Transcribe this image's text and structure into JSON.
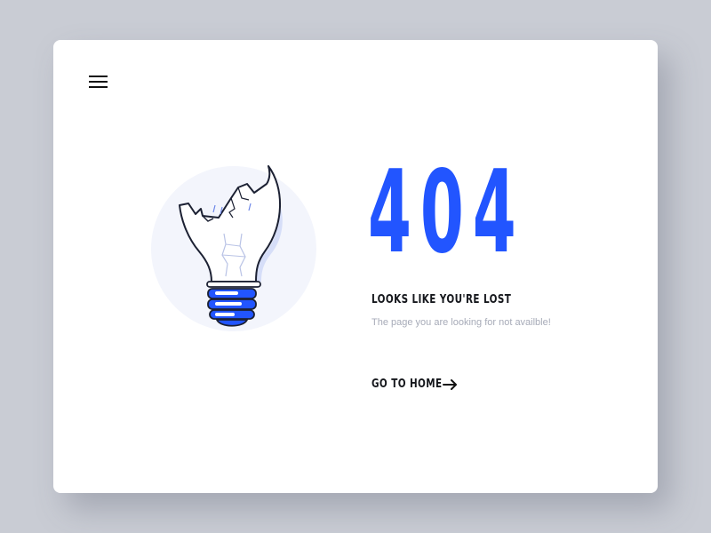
{
  "nav": {
    "menu_icon": "hamburger-menu-icon"
  },
  "illustration": {
    "icon": "broken-lightbulb-icon",
    "accent_color": "#2255ff"
  },
  "error": {
    "code": "404",
    "headline": "LOOKS LIKE YOU'RE LOST",
    "message": "The page you are looking for not availble!"
  },
  "cta": {
    "label": "GO TO HOME",
    "icon": "arrow-right-icon"
  },
  "colors": {
    "background": "#c9ccd4",
    "card": "#ffffff",
    "accent": "#2255ff",
    "text_dark": "#15171c",
    "text_muted": "#a7abb8"
  }
}
